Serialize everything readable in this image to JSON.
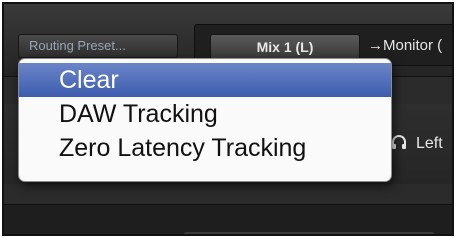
{
  "toolbar": {
    "routing_preset_label": "Routing Preset...",
    "mix_button_label": "Mix 1 (L)",
    "monitor_label": "→Monitor ("
  },
  "channel": {
    "headphone_icon": "headphone-icon",
    "side_label": "Left"
  },
  "menu": {
    "selected_index": 0,
    "items": [
      {
        "label": "Clear"
      },
      {
        "label": "DAW Tracking"
      },
      {
        "label": "Zero Latency Tracking"
      }
    ]
  },
  "colors": {
    "selection": "#4a67b8",
    "menu_bg": "#fafafa",
    "panel_bg": "#2b2b2b"
  }
}
